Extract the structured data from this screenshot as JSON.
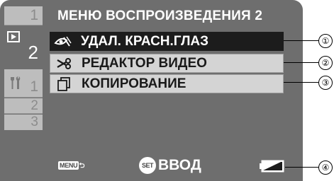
{
  "tabs": {
    "tab1": "1",
    "play": {
      "icon": "play-icon",
      "number": "2"
    },
    "tools": {
      "icon": "tools-icon",
      "number": "1"
    },
    "tools2": "2",
    "tools3": "3"
  },
  "menu": {
    "title": "МЕНЮ ВОСПРОИЗВЕДЕНИЯ 2",
    "items": [
      {
        "icon": "red-eye-icon",
        "label": "УДАЛ. КРАСН.ГЛАЗ",
        "selected": true
      },
      {
        "icon": "scissors-icon",
        "label": "РЕДАКТОР ВИДЕО",
        "selected": false
      },
      {
        "icon": "copy-icon",
        "label": "КОПИРОВАНИЕ",
        "selected": false
      }
    ]
  },
  "bottom_bar": {
    "menu_key": "MENU",
    "set_key": "SET",
    "set_label": "ВВОД",
    "battery_icon": "battery-icon"
  },
  "callouts": [
    "①",
    "②",
    "③",
    "④"
  ],
  "colors": {
    "screen_bg": "#6e6e6e",
    "selected_bg": "#1c1c1c",
    "item_bg": "#d4d4d4",
    "tab_bg": "#bdbdbd"
  }
}
